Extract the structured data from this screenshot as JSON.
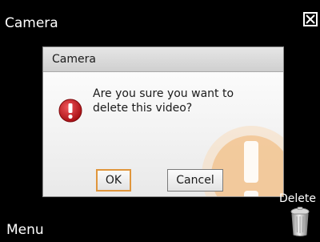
{
  "app": {
    "title": "Camera",
    "close_icon": "close-icon"
  },
  "dialog": {
    "title": "Camera",
    "icon": "alert-icon",
    "message": "Are you sure you want to delete this video?",
    "ok_label": "OK",
    "cancel_label": "Cancel"
  },
  "softkeys": {
    "left_label": "Menu",
    "right_label": "Delete",
    "right_icon": "trash-icon"
  },
  "colors": {
    "background": "#000000",
    "alert_red": "#c4161c",
    "focus_orange": "#e0963c",
    "watermark_orange": "#f2c08a"
  }
}
